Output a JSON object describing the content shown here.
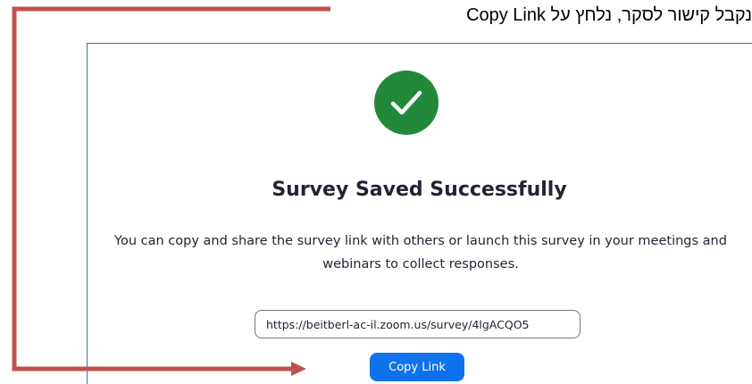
{
  "instruction": {
    "text": "נקבל קישור לסקר, נלחץ על Copy Link"
  },
  "dialog": {
    "icon": "checkmark-circle-icon",
    "title": "Survey Saved Successfully",
    "description": "You can copy and share the survey link with others or launch this survey in your meetings and webinars to collect responses.",
    "link_value": "https://beitberl-ac-il.zoom.us/survey/4lgACQO5",
    "copy_button_label": "Copy Link"
  },
  "colors": {
    "success_green": "#23893a",
    "button_blue": "#0e72ed",
    "annotation_red": "#c0504d",
    "panel_border": "#2e75b6"
  }
}
